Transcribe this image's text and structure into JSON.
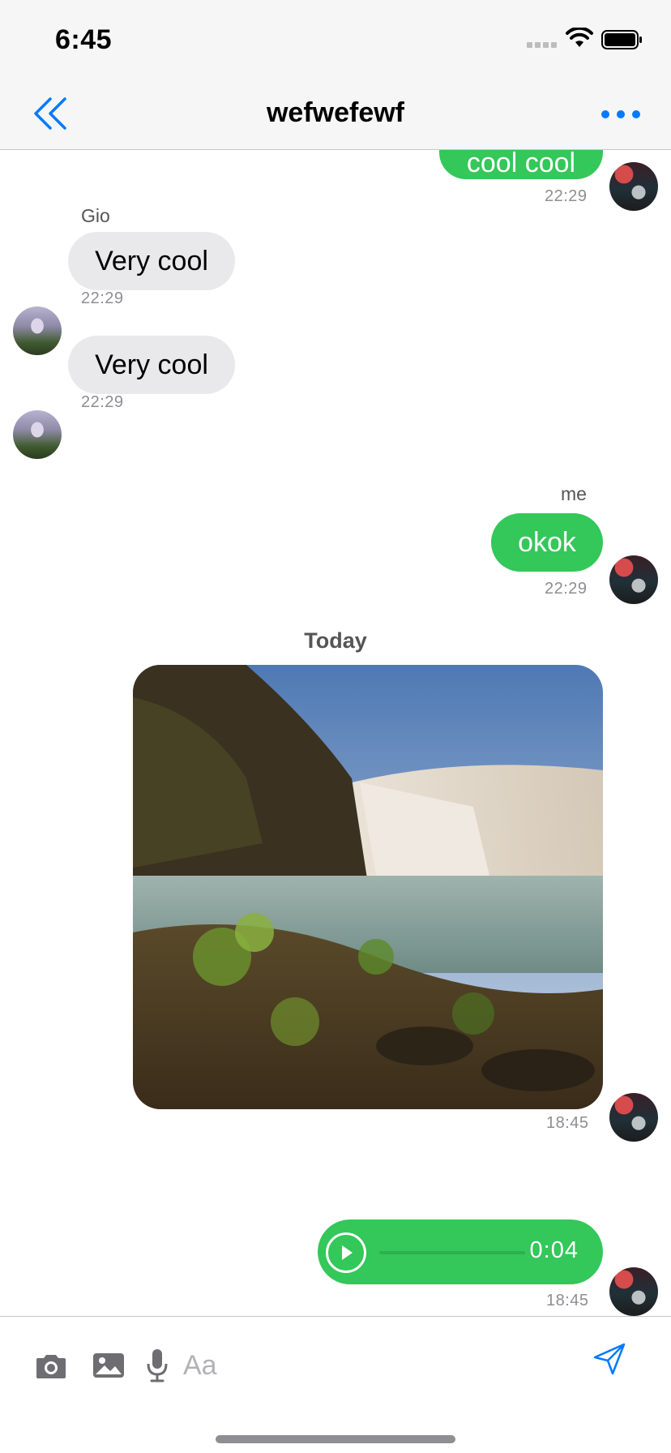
{
  "status_bar": {
    "time": "6:45"
  },
  "nav": {
    "title": "wefwefewf"
  },
  "messages": [
    {
      "direction": "outgoing",
      "text": "cool cool",
      "time": "22:29"
    },
    {
      "direction": "incoming",
      "sender": "Gio",
      "text": "Very cool",
      "time": "22:29"
    },
    {
      "direction": "incoming",
      "text": "Very cool",
      "time": "22:29"
    },
    {
      "direction": "outgoing",
      "sender": "me",
      "text": "okok",
      "time": "22:29"
    }
  ],
  "date_separator": "Today",
  "image_message": {
    "time": "18:45",
    "subject": "waterfall photo"
  },
  "voice_message": {
    "duration": "0:04",
    "time": "18:45"
  },
  "composer": {
    "placeholder": "Aa"
  },
  "colors": {
    "accent": "#007aff",
    "outgoing_bubble": "#34c759",
    "incoming_bubble": "#e9e9eb"
  }
}
